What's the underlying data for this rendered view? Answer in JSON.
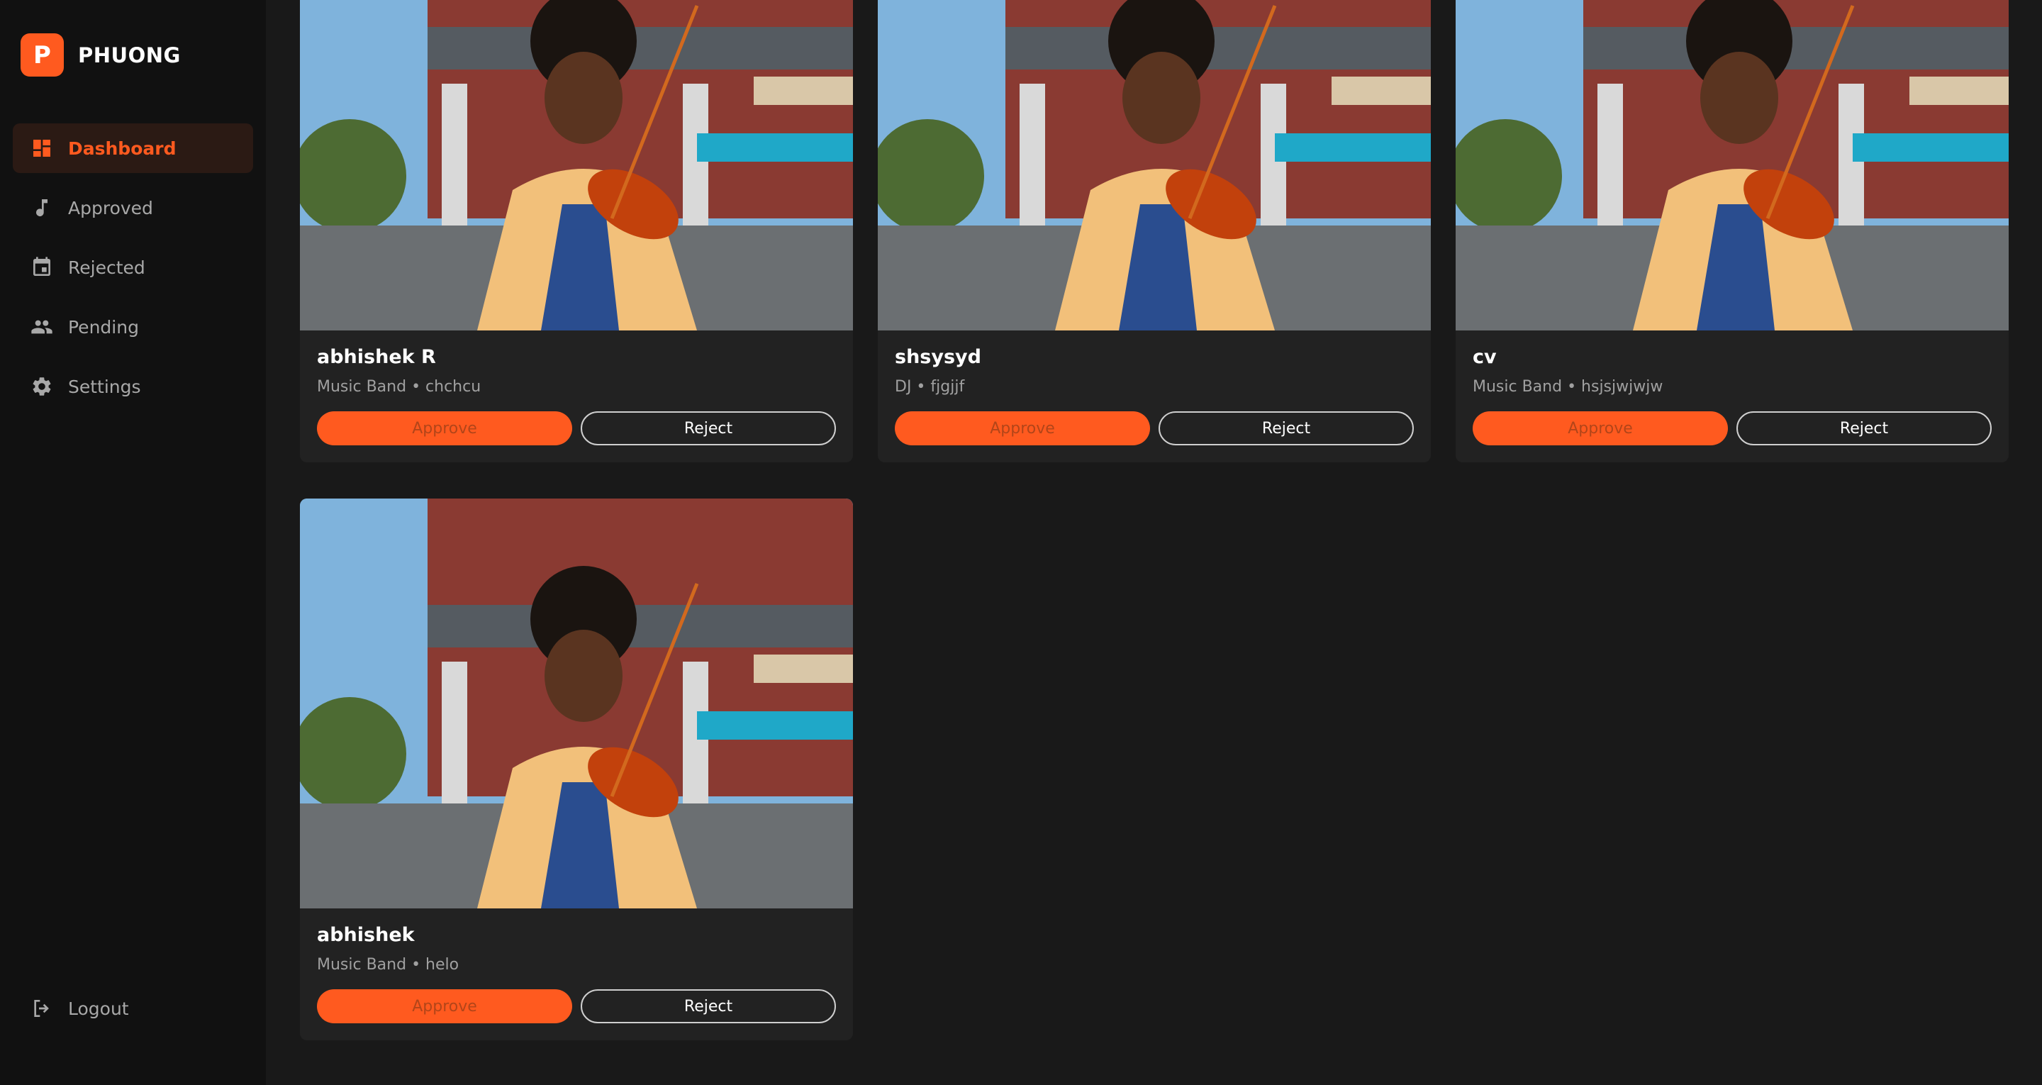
{
  "brand": {
    "logo_letter": "P",
    "name": "PHUONG"
  },
  "nav": [
    {
      "label": "Dashboard",
      "icon": "dashboard-icon",
      "active": true
    },
    {
      "label": "Approved",
      "icon": "music-note-icon",
      "active": false
    },
    {
      "label": "Rejected",
      "icon": "calendar-icon",
      "active": false
    },
    {
      "label": "Pending",
      "icon": "people-icon",
      "active": false
    },
    {
      "label": "Settings",
      "icon": "gear-icon",
      "active": false
    }
  ],
  "logout": {
    "label": "Logout",
    "icon": "logout-icon"
  },
  "cards": [
    {
      "name": "abhishek R",
      "meta": "Music Band • chchcu",
      "approve": "Approve",
      "reject": "Reject"
    },
    {
      "name": "shsysyd",
      "meta": "DJ • fjgjjf",
      "approve": "Approve",
      "reject": "Reject"
    },
    {
      "name": "cv",
      "meta": "Music Band • hsjsjwjwjw",
      "approve": "Approve",
      "reject": "Reject"
    },
    {
      "name": "abhishek",
      "meta": "Music Band • helo",
      "approve": "Approve",
      "reject": "Reject"
    }
  ],
  "colors": {
    "accent": "#ff5a1f",
    "sidebar_bg": "#111111",
    "main_bg": "#191919",
    "card_bg": "#222222"
  }
}
